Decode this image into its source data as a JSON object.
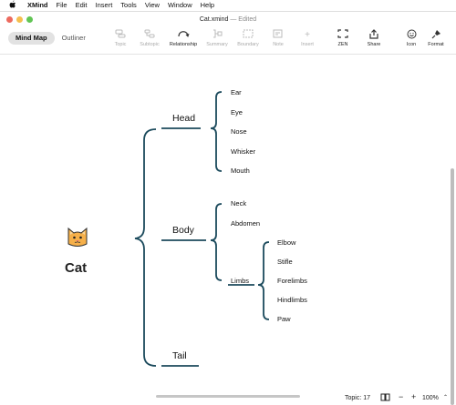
{
  "menubar": {
    "app_name": "XMind",
    "items": [
      "File",
      "Edit",
      "Insert",
      "Tools",
      "View",
      "Window",
      "Help"
    ]
  },
  "window": {
    "title": "Cat.xmind",
    "status": "— Edited"
  },
  "toolbar": {
    "views": [
      "Mind Map",
      "Outliner"
    ],
    "active_view": "Mind Map",
    "tools": [
      {
        "label": "Topic",
        "icon": "topic-icon",
        "enabled": false
      },
      {
        "label": "Subtopic",
        "icon": "subtopic-icon",
        "enabled": false
      },
      {
        "label": "Relationship",
        "icon": "relationship-icon",
        "enabled": true
      },
      {
        "label": "Summary",
        "icon": "summary-icon",
        "enabled": false
      },
      {
        "label": "Boundary",
        "icon": "boundary-icon",
        "enabled": false
      },
      {
        "label": "Note",
        "icon": "note-icon",
        "enabled": false
      },
      {
        "label": "Insert",
        "icon": "plus-icon",
        "enabled": false
      },
      {
        "label": "ZEN",
        "icon": "zen-icon",
        "enabled": true
      },
      {
        "label": "Share",
        "icon": "share-icon",
        "enabled": true
      },
      {
        "label": "Icon",
        "icon": "smiley-icon",
        "enabled": true
      },
      {
        "label": "Format",
        "icon": "format-icon",
        "enabled": true
      }
    ]
  },
  "mindmap": {
    "root": "Cat",
    "root_icon": "cat-face-icon",
    "branches": [
      {
        "label": "Head",
        "children": [
          "Ear",
          "Eye",
          "Nose",
          "Whisker",
          "Mouth"
        ]
      },
      {
        "label": "Body",
        "children": [
          "Neck",
          "Abdomen",
          "Limbs"
        ],
        "sub": {
          "Limbs": [
            "Elbow",
            "Stifle",
            "Forelimbs",
            "Hindlimbs",
            "Paw"
          ]
        }
      },
      {
        "label": "Tail",
        "children": []
      }
    ],
    "line_color": "#1b4a5c"
  },
  "statusbar": {
    "topic_count": "Topic: 17",
    "zoom": "100%",
    "minus": "−",
    "plus": "+"
  },
  "colors": {
    "close": "#ed6a5e",
    "minimize": "#f5bf4f",
    "zoom": "#61c554"
  }
}
